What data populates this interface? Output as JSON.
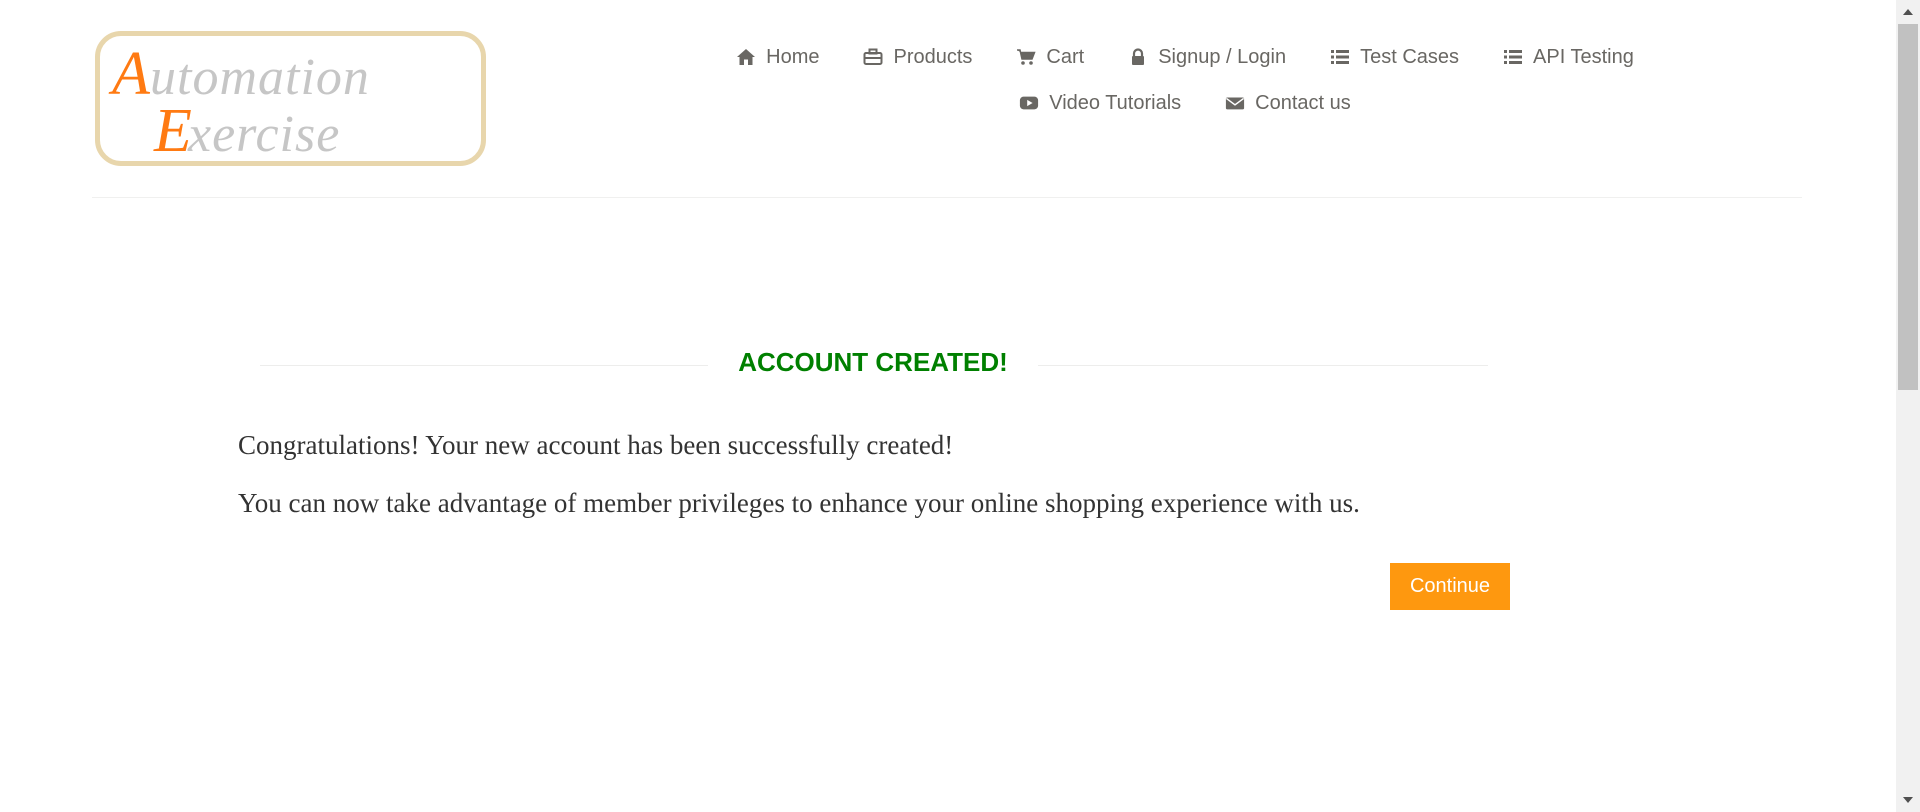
{
  "logo": {
    "alt_text": "Automation Exercise",
    "line1": "Automation",
    "line2": "Exercise",
    "letter_color": "#ff7a12",
    "text_color": "#c6c6c6"
  },
  "nav": {
    "items": [
      {
        "label": "Home",
        "icon": "home-icon"
      },
      {
        "label": "Products",
        "icon": "products-icon"
      },
      {
        "label": "Cart",
        "icon": "cart-icon"
      },
      {
        "label": "Signup / Login",
        "icon": "lock-icon"
      },
      {
        "label": "Test Cases",
        "icon": "list-icon"
      },
      {
        "label": "API Testing",
        "icon": "list-icon"
      },
      {
        "label": "Video Tutorials",
        "icon": "youtube-play-icon"
      },
      {
        "label": "Contact us",
        "icon": "envelope-icon"
      }
    ]
  },
  "content": {
    "title": "ACCOUNT CREATED!",
    "message_1": "Congratulations! Your new account has been successfully created!",
    "message_2": "You can now take advantage of member privileges to enhance your online shopping experience with us.",
    "continue_label": "Continue"
  },
  "colors": {
    "title": "#008000",
    "button": "#fe980f",
    "nav_text": "#696763",
    "logo_border": "#e8d6ac"
  }
}
